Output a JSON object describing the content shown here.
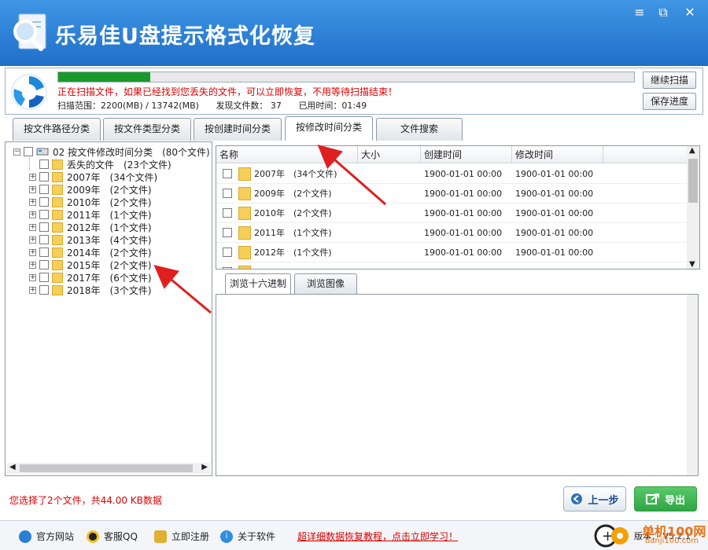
{
  "app": {
    "title": "乐易佳U盘提示格式化恢复"
  },
  "window_controls": {
    "help": "≡",
    "restore": "⧉",
    "close": "✕"
  },
  "scan": {
    "progress_percent": 16,
    "message": "正在扫描文件，如果已经找到您丢失的文件，可以立即恢复，不用等待扫描结束！",
    "range": "扫描范围：2200(MB) / 13742(MB)",
    "found": "发现文件数： 37",
    "time": "已用时间：01:49",
    "continue_label": "继续扫描",
    "save_label": "保存进度"
  },
  "tabs": [
    "按文件路径分类",
    "按文件类型分类",
    "按创建时间分类",
    "按修改时间分类",
    "文件搜索"
  ],
  "tree": {
    "root_label": "02  按文件修改时间分类",
    "root_count": "(80个文件)",
    "items": [
      {
        "label": "丢失的文件",
        "count": "(23个文件)"
      },
      {
        "label": "2007年",
        "count": "(34个文件)"
      },
      {
        "label": "2009年",
        "count": "(2个文件)"
      },
      {
        "label": "2010年",
        "count": "(2个文件)"
      },
      {
        "label": "2011年",
        "count": "(1个文件)"
      },
      {
        "label": "2012年",
        "count": "(1个文件)"
      },
      {
        "label": "2013年",
        "count": "(4个文件)"
      },
      {
        "label": "2014年",
        "count": "(2个文件)"
      },
      {
        "label": "2015年",
        "count": "(2个文件)"
      },
      {
        "label": "2017年",
        "count": "(6个文件)"
      },
      {
        "label": "2018年",
        "count": "(3个文件)"
      }
    ]
  },
  "list": {
    "headers": [
      "名称",
      "大小",
      "创建时间",
      "修改时间"
    ],
    "rows": [
      {
        "name": "2007年",
        "count": "(34个文件)",
        "created": "1900-01-01  00:00",
        "modified": "1900-01-01  00:00"
      },
      {
        "name": "2009年",
        "count": "(2个文件)",
        "created": "1900-01-01  00:00",
        "modified": "1900-01-01  00:00"
      },
      {
        "name": "2010年",
        "count": "(2个文件)",
        "created": "1900-01-01  00:00",
        "modified": "1900-01-01  00:00"
      },
      {
        "name": "2011年",
        "count": "(1个文件)",
        "created": "1900-01-01  00:00",
        "modified": "1900-01-01  00:00"
      },
      {
        "name": "2012年",
        "count": "(1个文件)",
        "created": "1900-01-01  00:00",
        "modified": "1900-01-01  00:00"
      }
    ]
  },
  "preview_tabs": [
    "浏览十六进制",
    "浏览图像"
  ],
  "selection_status": "您选择了2个文件，共44.00 KB数据",
  "buttons": {
    "back": "上一步",
    "export": "导出"
  },
  "statusbar": {
    "website": "官方网站",
    "qq": "客服QQ",
    "register": "立即注册",
    "about": "关于软件",
    "tutorial": "超详细数据恢复教程，点击立即学习！",
    "version": "版本：  V5.2.1"
  },
  "watermark": {
    "text": "单机100网",
    "url": "danji100.com"
  },
  "colors": {
    "titlebar": "#2b7fd6",
    "progress": "#1a9a2a",
    "accent_red": "#dd0000",
    "export_green": "#2fa646"
  }
}
